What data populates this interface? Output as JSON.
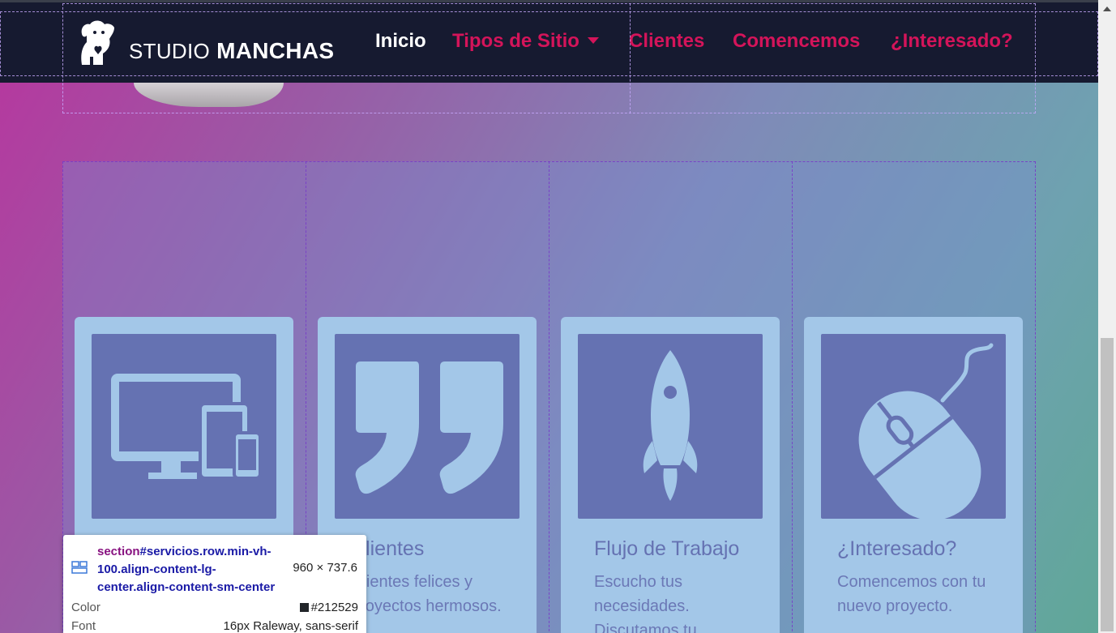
{
  "navbar": {
    "brand_light": "STUDIO",
    "brand_bold": "MANCHAS",
    "links": [
      {
        "label": "Inicio"
      },
      {
        "label": "Tipos de Sitio"
      },
      {
        "label": "Clientes"
      },
      {
        "label": "Comencemos"
      },
      {
        "label": "¿Interesado?"
      }
    ]
  },
  "cards": [
    {
      "icon": "devices-icon",
      "title": "",
      "text": ""
    },
    {
      "icon": "quote-icon",
      "title": "Clientes",
      "text": "Clientes felices y proyectos hermosos."
    },
    {
      "icon": "rocket-icon",
      "title": "Flujo de Trabajo",
      "text": "Escucho tus necesidades. Discutamos tu"
    },
    {
      "icon": "mouse-icon",
      "title": "¿Interesado?",
      "text": "Comencemos con tu nuevo proyecto."
    }
  ],
  "inspector": {
    "tag": "section",
    "selector": "#servicios.row.min-vh-100.align-content-lg-center.align-content-sm-center",
    "size": "960 × 737.6",
    "color_label": "Color",
    "color_value": "#212529",
    "font_label": "Font",
    "font_value": "16px Raleway, sans-serif"
  },
  "colors": {
    "nav_bg": "#161a30",
    "nav_link": "#d4145a",
    "card_bg": "#a3c7e8",
    "icon_bg": "#6572b2"
  }
}
